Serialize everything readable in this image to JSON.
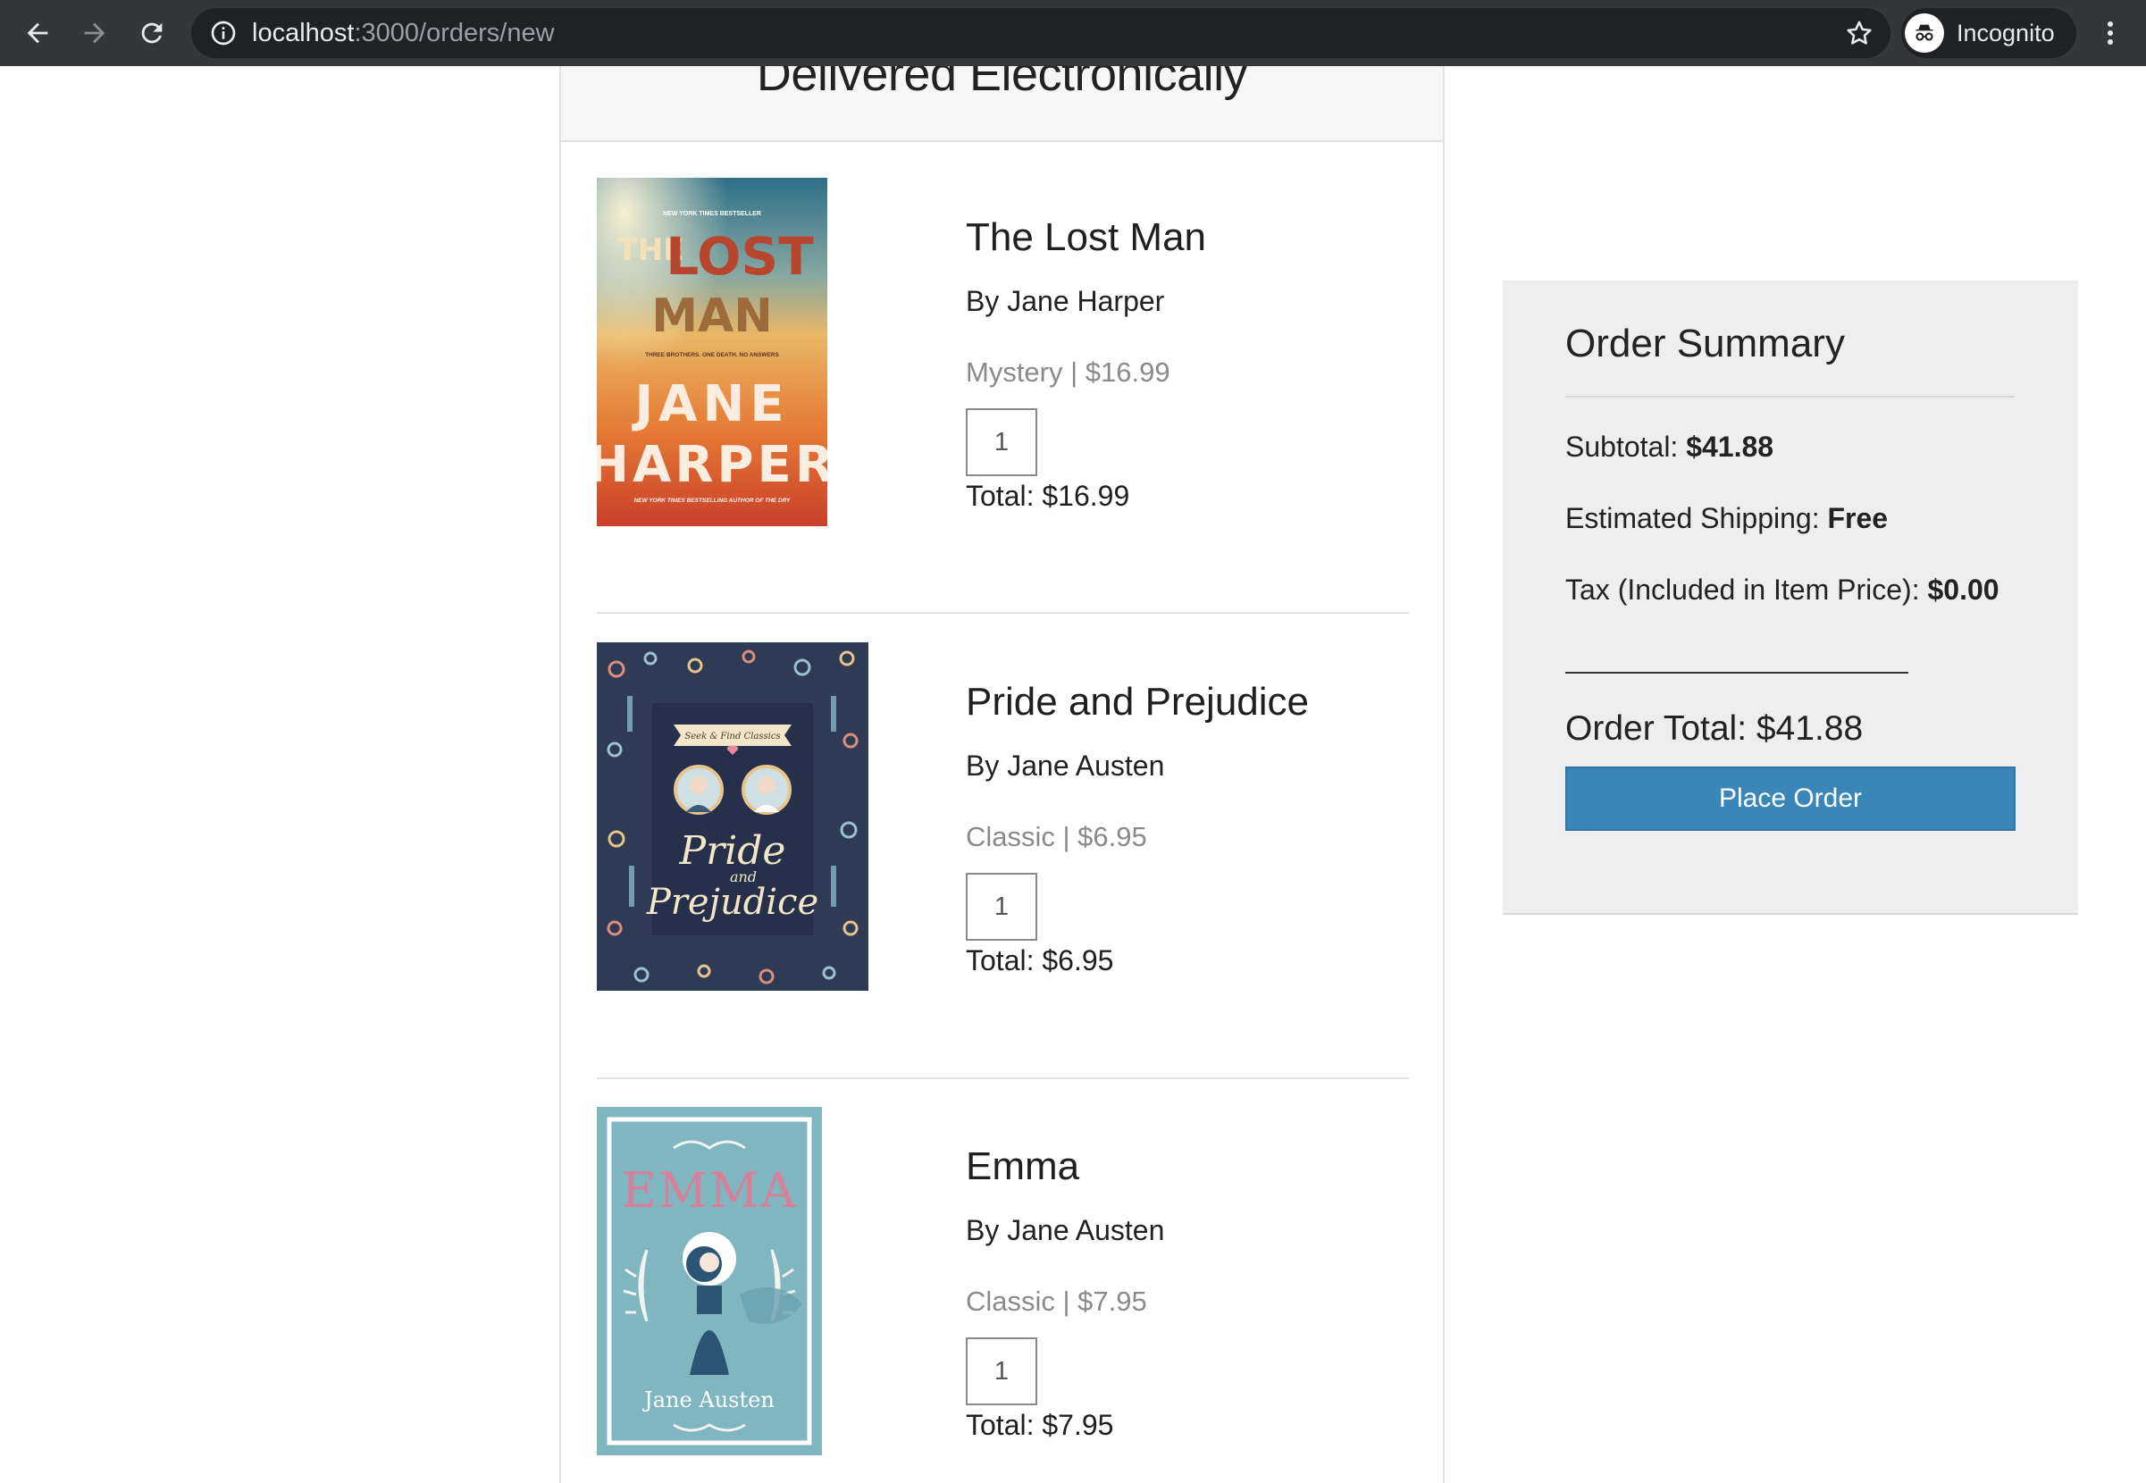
{
  "browser": {
    "url_host": "localhost",
    "url_path": ":3000/orders/new",
    "profile_label": "Incognito",
    "icons": {
      "back": "back-arrow-icon",
      "forward": "forward-arrow-icon",
      "reload": "reload-icon",
      "info": "info-icon",
      "bookmark": "star-icon",
      "incognito": "incognito-icon",
      "menu": "kebab-menu-icon"
    }
  },
  "panel": {
    "title": "Delivered Electronically"
  },
  "items": [
    {
      "title": "The Lost Man",
      "author": "By Jane Harper",
      "meta": "Mystery | $16.99",
      "quantity": "1",
      "total": "Total: $16.99",
      "cover": {
        "small_top": "NEW YORK TIMES BESTSELLER",
        "the": "THE",
        "lost": "LOST",
        "man": "MAN",
        "tagline": "THREE BROTHERS. ONE DEATH. NO ANSWERS",
        "author_first": "JANE",
        "author_last": "HARPER",
        "footer": "NEW YORK TIMES BESTSELLING AUTHOR OF THE DRY"
      }
    },
    {
      "title": "Pride and Prejudice",
      "author": "By Jane Austen",
      "meta": "Classic | $6.95",
      "quantity": "1",
      "total": "Total: $6.95",
      "cover": {
        "banner": "Seek & Find Classics",
        "line1": "Pride",
        "line2": "and",
        "line3": "Prejudice"
      }
    },
    {
      "title": "Emma",
      "author": "By Jane Austen",
      "meta": "Classic | $7.95",
      "quantity": "1",
      "total": "Total: $7.95",
      "cover": {
        "title": "EMMA",
        "author": "Jane Austen"
      }
    }
  ],
  "summary": {
    "title": "Order Summary",
    "subtotal_label": "Subtotal: ",
    "subtotal_value": "$41.88",
    "shipping_label": "Estimated Shipping: ",
    "shipping_value": "Free",
    "tax_label": "Tax (Included in Item Price): ",
    "tax_value": "$0.00",
    "order_total": "Order Total: $41.88",
    "button_label": "Place Order"
  },
  "colors": {
    "chrome_bg": "#35363a",
    "omnibox_bg": "#202124",
    "button_blue": "#3a86b9",
    "summary_bg": "#eeeeee"
  }
}
